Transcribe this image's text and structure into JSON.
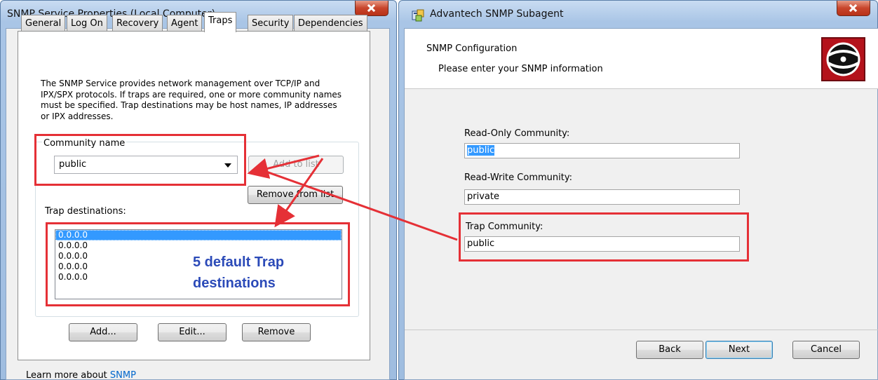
{
  "left_window": {
    "title": "SNMP Service Properties (Local Computer)",
    "tabs": [
      {
        "label": "General"
      },
      {
        "label": "Log On"
      },
      {
        "label": "Recovery"
      },
      {
        "label": "Agent"
      },
      {
        "label": "Traps"
      },
      {
        "label": "Security"
      },
      {
        "label": "Dependencies"
      }
    ],
    "active_tab": "Traps",
    "description": "The SNMP Service provides network management over TCP/IP and IPX/SPX protocols. If traps are required, one or more community names must be specified. Trap destinations may be host names, IP addresses or IPX addresses.",
    "community_label": "Community name",
    "community_value": "public",
    "add_to_list_label": "Add to list",
    "remove_from_list_label": "Remove from list",
    "trap_destinations_label": "Trap destinations:",
    "trap_destinations": [
      "0.0.0.0",
      "0.0.0.0",
      "0.0.0.0",
      "0.0.0.0",
      "0.0.0.0"
    ],
    "callout_line1": "5 default Trap",
    "callout_line2": "destinations",
    "add_label": "Add...",
    "edit_label": "Edit...",
    "remove_label": "Remove",
    "learn_more_prefix": "Learn more about",
    "learn_more_link": "SNMP"
  },
  "right_window": {
    "title": "Advantech SNMP Subagent",
    "header_title": "SNMP Configuration",
    "header_subtitle": "Please enter your SNMP information",
    "read_only_label": "Read-Only Community:",
    "read_only_value": "public",
    "read_write_label": "Read-Write Community:",
    "read_write_value": "private",
    "trap_label": "Trap Community:",
    "trap_value": "public",
    "back_label": "Back",
    "next_label": "Next",
    "cancel_label": "Cancel"
  },
  "colors": {
    "annotation_red": "#e53036",
    "callout_blue": "#2b4ab8",
    "selection_blue": "#3399ff"
  }
}
